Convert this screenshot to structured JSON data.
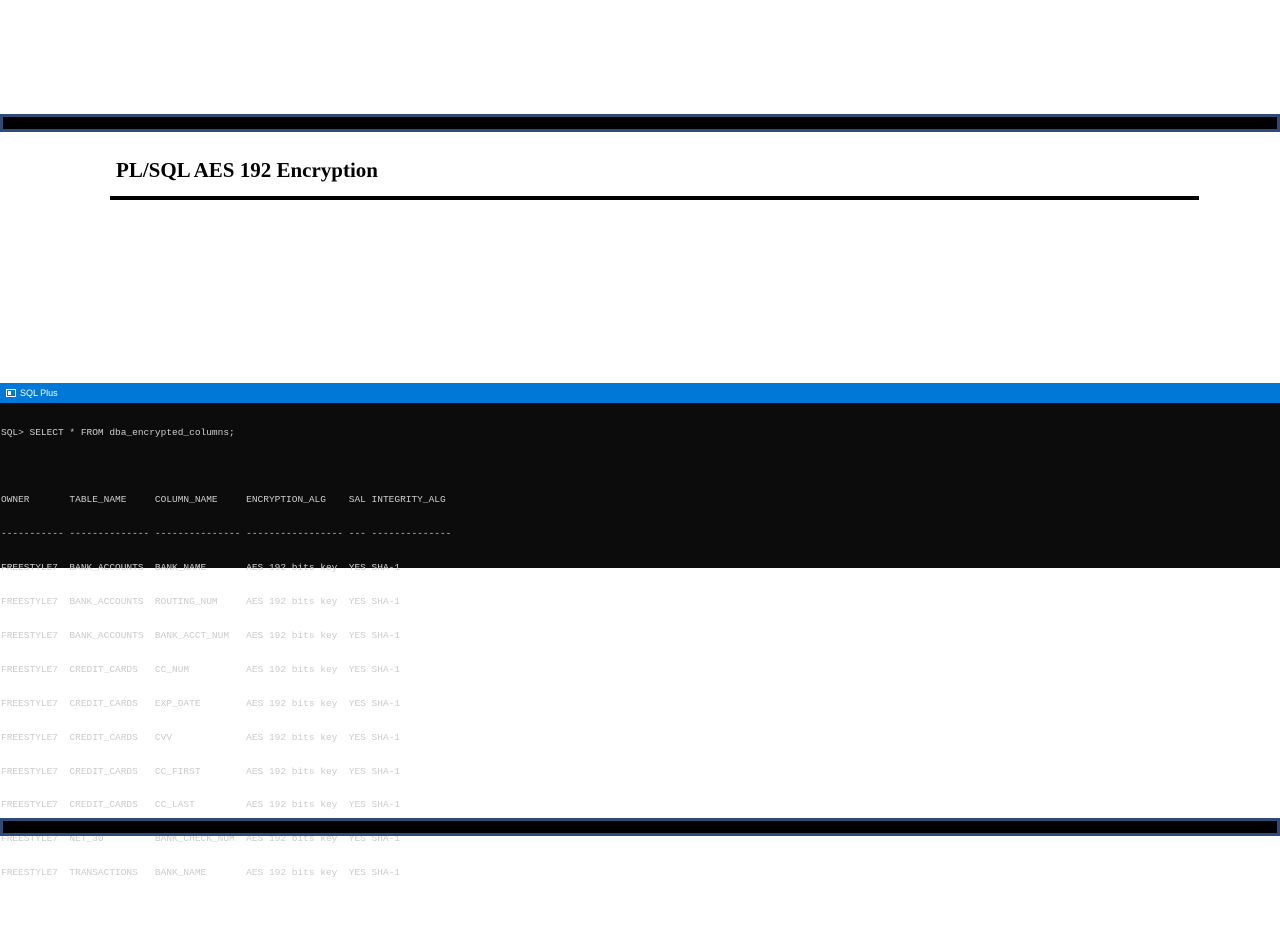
{
  "slide": {
    "title": "PL/SQL AES 192 Encryption"
  },
  "console": {
    "window_title": "SQL Plus",
    "icon": "console-window-icon",
    "command_line": "SQL> SELECT * FROM dba_encrypted_columns;",
    "header_line": "OWNER       TABLE_NAME     COLUMN_NAME     ENCRYPTION_ALG    SAL INTEGRITY_ALG",
    "separator_line": "----------- -------------- --------------- ----------------- --- --------------",
    "columns": [
      "OWNER",
      "TABLE_NAME",
      "COLUMN_NAME",
      "ENCRYPTION_ALG",
      "SAL",
      "INTEGRITY_ALG"
    ],
    "rows": [
      "FREESTYLE7  BANK_ACCOUNTS  BANK_NAME       AES 192 bits key  YES SHA-1",
      "FREESTYLE7  BANK_ACCOUNTS  ROUTING_NUM     AES 192 bits key  YES SHA-1",
      "FREESTYLE7  BANK_ACCOUNTS  BANK_ACCT_NUM   AES 192 bits key  YES SHA-1",
      "FREESTYLE7  CREDIT_CARDS   CC_NUM          AES 192 bits key  YES SHA-1",
      "FREESTYLE7  CREDIT_CARDS   EXP_DATE        AES 192 bits key  YES SHA-1",
      "FREESTYLE7  CREDIT_CARDS   CVV             AES 192 bits key  YES SHA-1",
      "FREESTYLE7  CREDIT_CARDS   CC_FIRST        AES 192 bits key  YES SHA-1",
      "FREESTYLE7  CREDIT_CARDS   CC_LAST         AES 192 bits key  YES SHA-1",
      "FREESTYLE7  NET_30         BANK_CHECK_NUM  AES 192 bits key  YES SHA-1",
      "FREESTYLE7  TRANSACTIONS   BANK_NAME       AES 192 bits key  YES SHA-1"
    ]
  }
}
